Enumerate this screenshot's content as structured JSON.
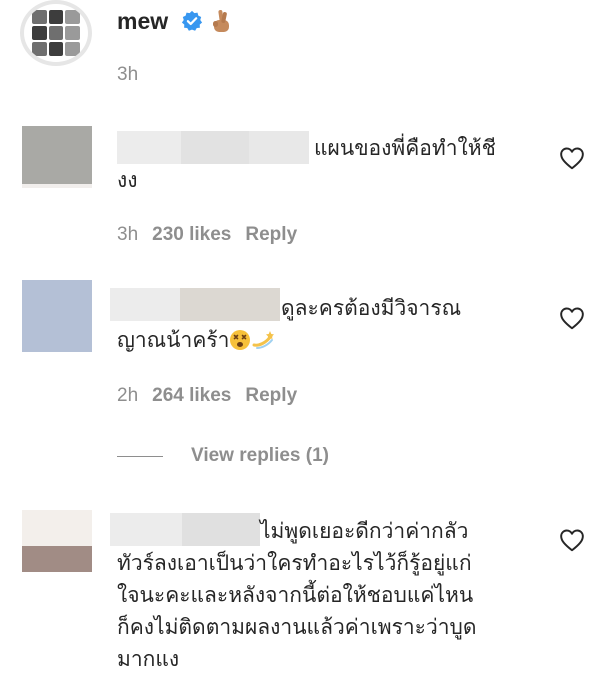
{
  "post": {
    "username": "mew",
    "time": "3h",
    "verified_icon": "verified-badge-icon",
    "emoji": "crossed-fingers-emoji"
  },
  "comments": [
    {
      "text_line1": "แผนของพี่คือทำให้ชี",
      "text_line2": "งง",
      "time": "3h",
      "likes": "230 likes",
      "reply": "Reply"
    },
    {
      "text_line1": "ดูละครต้องมีวิจารณ",
      "text_line2": "ญาณน้าคร้า",
      "time": "2h",
      "likes": "264 likes",
      "reply": "Reply"
    },
    {
      "text_lines": [
        "ไม่พูดเยอะดีกว่าค่ากลัว",
        "ทัวร์ลงเอาเป็นว่าใครทำอะไรไว้ก็รู้อยู่แก่",
        "ใจนะคะและหลังจากนี้ต่อให้ชอบแค่ไหน",
        "ก็คงไม่ติดตามผลงานแล้วค่าเพราะว่าบูด",
        "มากแง"
      ]
    }
  ],
  "view_replies": "View replies (1)",
  "colors": {
    "text": "#262626",
    "muted": "#8e8e8e",
    "verified": "#3897f0"
  }
}
